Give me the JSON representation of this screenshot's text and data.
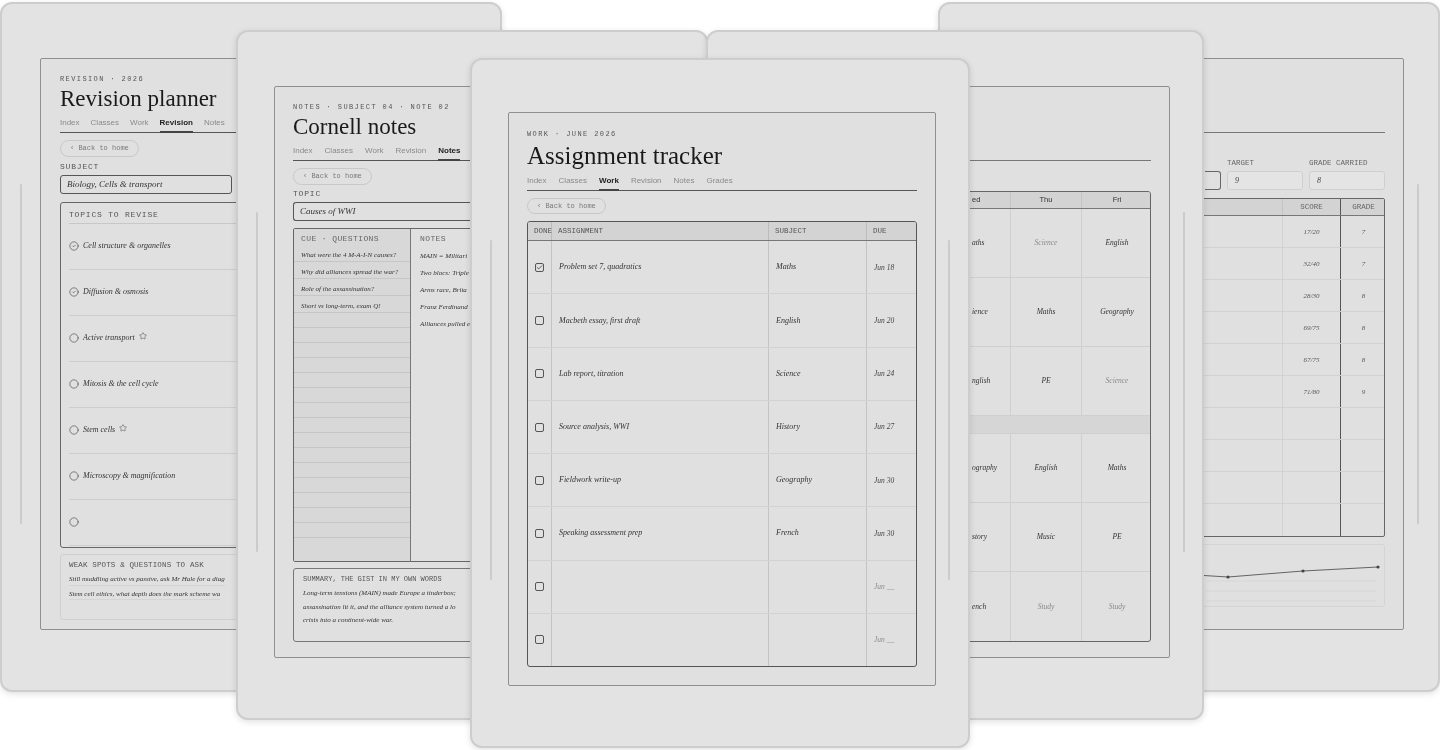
{
  "devices": [
    {
      "kind": "revision",
      "eyebrow": "REVISION · 2026",
      "title": "Revision planner",
      "tabs": [
        {
          "label": "Index",
          "selected": false
        },
        {
          "label": "Classes",
          "selected": false
        },
        {
          "label": "Work",
          "selected": false
        },
        {
          "label": "Revision",
          "selected": true
        },
        {
          "label": "Notes",
          "selected": false
        }
      ],
      "back": "‹ Back to home",
      "subject_label": "SUBJECT",
      "subject": "Biology, Cells & transport",
      "topics_heading": "TOPICS TO REVISE",
      "topics": [
        {
          "text": "Cell structure & organelles",
          "checked": true,
          "starred": false
        },
        {
          "text": "Diffusion & osmosis",
          "checked": true,
          "starred": false
        },
        {
          "text": "Active transport",
          "checked": false,
          "starred": true
        },
        {
          "text": "Mitosis & the cell cycle",
          "checked": false,
          "starred": false
        },
        {
          "text": "Stem cells",
          "checked": false,
          "starred": true
        },
        {
          "text": "Microscopy & magnification",
          "checked": false,
          "starred": false
        },
        {
          "checked": false,
          "starred": false
        }
      ],
      "weak_heading": "WEAK SPOTS & QUESTIONS TO ASK",
      "weak_lines": [
        "Still muddling active vs passive, ask Mr Hale for a diag",
        "Stem cell ethics, what depth does the mark scheme wa"
      ]
    },
    {
      "kind": "cornell",
      "eyebrow": "NOTES · SUBJECT 04 · NOTE 02",
      "title": "Cornell notes",
      "tabs": [
        {
          "label": "Index",
          "selected": false
        },
        {
          "label": "Classes",
          "selected": false
        },
        {
          "label": "Work",
          "selected": false
        },
        {
          "label": "Revision",
          "selected": false
        },
        {
          "label": "Notes",
          "selected": true
        }
      ],
      "back": "‹ Back to home",
      "topic_label": "TOPIC",
      "topic": "Causes of WWI",
      "cue_heading": "CUE · QUESTIONS",
      "cues": [
        "What were the 4 M-A-I-N causes?",
        "Why did alliances spread the war?",
        "Role of the assassination?",
        "Short vs long-term, exam Q!"
      ],
      "notes_heading": "NOTES",
      "notes": [
        "MAIN = Militari",
        "Two blocs: Triple",
        "Arms race, Brita",
        "Franz Ferdinand",
        "Alliances pulled e"
      ],
      "summary_heading": "SUMMARY, THE GIST IN MY OWN WORDS",
      "summary_lines": [
        "Long-term tensions (MAIN) made Europe a tinderbox;",
        "assassination lit it, and the alliance system turned a lo",
        "crisis into a continent-wide war."
      ]
    },
    {
      "kind": "tracker",
      "eyebrow": "WORK · JUNE 2026",
      "title": "Assignment tracker",
      "tabs": [
        {
          "label": "Index",
          "selected": false
        },
        {
          "label": "Classes",
          "selected": false
        },
        {
          "label": "Work",
          "selected": true
        },
        {
          "label": "Revision",
          "selected": false
        },
        {
          "label": "Notes",
          "selected": false
        },
        {
          "label": "Grades",
          "selected": false
        }
      ],
      "back": "‹ Back to home",
      "columns": [
        "DONE",
        "ASSIGNMENT",
        "SUBJECT",
        "DUE"
      ],
      "rows": [
        {
          "kind": "entry",
          "done": true,
          "assignment": "Problem set 7, quadratics",
          "subject": "Maths",
          "due": "Jun 18"
        },
        {
          "kind": "entry",
          "done": false,
          "assignment": "Macbeth essay, first draft",
          "subject": "English",
          "due": "Jun 20"
        },
        {
          "kind": "entry",
          "done": false,
          "assignment": "Lab report, titration",
          "subject": "Science",
          "due": "Jun 24"
        },
        {
          "kind": "entry",
          "done": false,
          "assignment": "Source analysis, WWI",
          "subject": "History",
          "due": "Jun 27"
        },
        {
          "kind": "entry",
          "done": false,
          "assignment": "Fieldwork write-up",
          "subject": "Geography",
          "due": "Jun 30"
        },
        {
          "kind": "entry",
          "done": false,
          "assignment": "Speaking assessment prep",
          "subject": "French",
          "due": "Jun 30"
        },
        {
          "kind": "blank",
          "done": false,
          "due": "Jun __"
        },
        {
          "kind": "blank",
          "done": false,
          "due": "Jun __"
        }
      ]
    },
    {
      "kind": "timetable",
      "columns": [
        "ed",
        "Thu",
        "Fri"
      ],
      "rows": [
        {
          "kind": "lessons",
          "cells": [
            {
              "text": "aths",
              "muted": false
            },
            {
              "text": "Science",
              "muted": true
            },
            {
              "text": "English",
              "muted": false
            }
          ]
        },
        {
          "kind": "lessons",
          "cells": [
            {
              "text": "ience",
              "muted": false
            },
            {
              "text": "Maths",
              "muted": false
            },
            {
              "text": "Geography",
              "muted": false
            }
          ]
        },
        {
          "kind": "lessons",
          "cells": [
            {
              "text": "nglish",
              "muted": false
            },
            {
              "text": "PE",
              "muted": false
            },
            {
              "text": "Science",
              "muted": true
            }
          ]
        },
        {
          "kind": "break"
        },
        {
          "kind": "lessons",
          "cells": [
            {
              "text": "ography",
              "muted": false
            },
            {
              "text": "English",
              "muted": false
            },
            {
              "text": "Maths",
              "muted": false
            }
          ]
        },
        {
          "kind": "lessons",
          "cells": [
            {
              "text": "story",
              "muted": false
            },
            {
              "text": "Music",
              "muted": false
            },
            {
              "text": "PE",
              "muted": false
            }
          ]
        },
        {
          "kind": "lessons",
          "cells": [
            {
              "text": "ench",
              "muted": false
            },
            {
              "text": "Study",
              "muted": true
            },
            {
              "text": "Study",
              "muted": true
            }
          ]
        }
      ]
    },
    {
      "kind": "grades",
      "fields": [
        {
          "label": "TARGET",
          "value": "9"
        },
        {
          "label": "GRADE CARRIED",
          "value": "8"
        }
      ],
      "columns": [
        "SCORE",
        "GRADE"
      ],
      "rows": [
        {
          "kind": "result",
          "score": "17/20",
          "grade": "7"
        },
        {
          "kind": "result",
          "score": "32/40",
          "grade": "7"
        },
        {
          "kind": "result",
          "score": "28/30",
          "grade": "8"
        },
        {
          "kind": "result",
          "score": "69/75",
          "grade": "8"
        },
        {
          "kind": "result",
          "score": "67/75",
          "grade": "8"
        },
        {
          "kind": "result",
          "score": "71/80",
          "grade": "9"
        },
        {
          "kind": "blank"
        },
        {
          "kind": "blank"
        },
        {
          "kind": "blank"
        },
        {
          "kind": "blank"
        }
      ]
    }
  ]
}
